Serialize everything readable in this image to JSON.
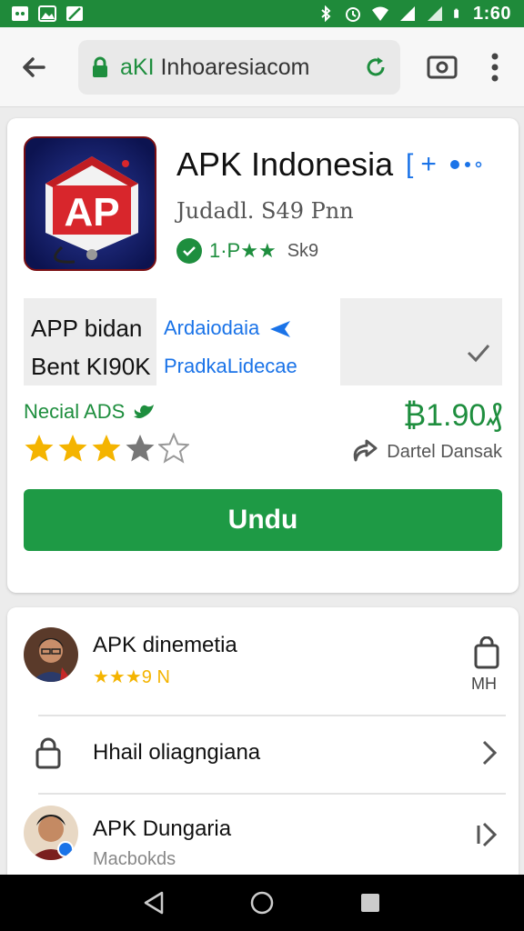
{
  "status_bar": {
    "time": "1:60",
    "icons": [
      "notification-icon",
      "image-icon",
      "blocked-icon",
      "bluetooth-icon",
      "alarm-icon",
      "wifi-icon",
      "signal-icon",
      "signal-icon",
      "battery-icon"
    ]
  },
  "browser": {
    "url_host": "aKI",
    "url_rest": " Inhoaresiacom",
    "icons": [
      "back-arrow-icon",
      "lock-icon",
      "reload-icon",
      "tab-icon",
      "more-vert-icon"
    ]
  },
  "app": {
    "title": "APK Indonesia",
    "title_actions": {
      "bracket": "[",
      "plus": "+"
    },
    "icon_text": "AP",
    "developer": "Judadl. S49 Pnn",
    "rating_label": "1·P★★",
    "rating_count": "Sk9"
  },
  "info": {
    "labels": [
      "APP bidan",
      "Bent KI90K"
    ],
    "values": [
      "Ardaiodaia",
      "PradkaLidecae"
    ]
  },
  "meta": {
    "social": "Necial ADS",
    "price": "₿1.90₰",
    "stars": 3.5,
    "share_label": "Dartel Dansak"
  },
  "install_button": "Undu",
  "list": {
    "items": [
      {
        "title": "APK dinemetia",
        "sub": "★★★9 N",
        "action_label": "MH"
      },
      {
        "title": "Hhail oliagngiana"
      },
      {
        "title": "APK Dungaria",
        "sub": "Macbokds"
      }
    ]
  },
  "colors": {
    "brand_green": "#1e9a45",
    "status_green": "#1f8a3a",
    "link_blue": "#1a73e8",
    "star_yellow": "#f4b400"
  }
}
